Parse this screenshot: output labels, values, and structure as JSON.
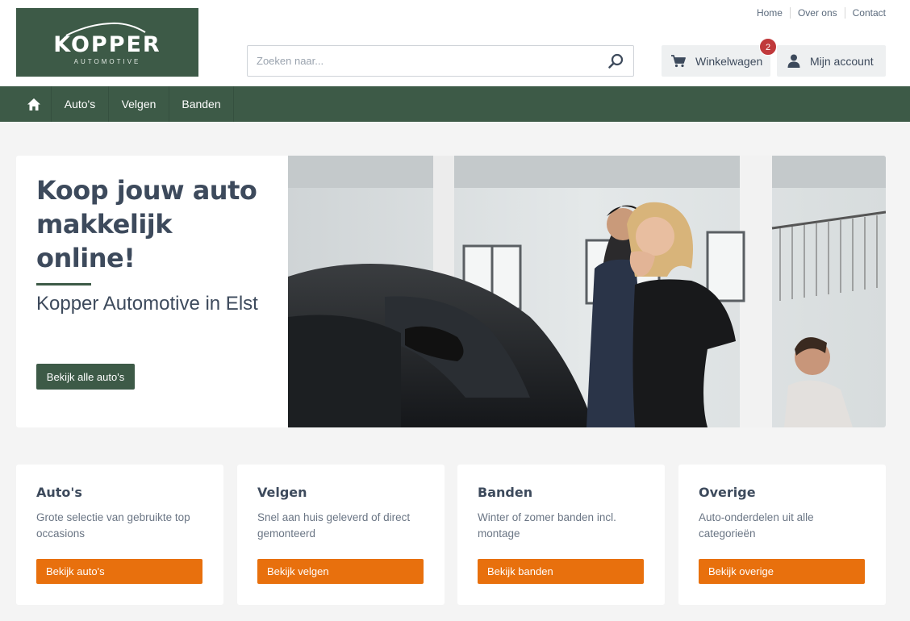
{
  "logo": {
    "word": "KOPPER",
    "sub": "AUTOMOTIVE"
  },
  "top_links": [
    "Home",
    "Over ons",
    "Contact"
  ],
  "search": {
    "placeholder": "Zoeken naar...",
    "value": ""
  },
  "cart": {
    "label": "Winkelwagen",
    "count": "2"
  },
  "account": {
    "label": "Mijn account"
  },
  "nav": {
    "items": [
      "Auto's",
      "Velgen",
      "Banden"
    ]
  },
  "hero": {
    "title": "Koop jouw auto makkelijk online!",
    "subtitle": "Kopper Automotive in Elst",
    "button": "Bekijk alle auto's"
  },
  "cards": [
    {
      "title": "Auto's",
      "desc": "Grote selectie van gebruikte top occasions",
      "button": "Bekijk auto's"
    },
    {
      "title": "Velgen",
      "desc": "Snel aan huis geleverd of direct gemonteerd",
      "button": "Bekijk velgen"
    },
    {
      "title": "Banden",
      "desc": "Winter of zomer banden incl. montage",
      "button": "Bekijk banden"
    },
    {
      "title": "Overige",
      "desc": "Auto-onderdelen uit alle categorieën",
      "button": "Bekijk overige"
    }
  ],
  "colors": {
    "brand_green": "#3d5a47",
    "accent_orange": "#e8700d",
    "badge_red": "#c0393b",
    "text": "#3d4a5c"
  },
  "icons": [
    "home-icon",
    "search-icon",
    "cart-icon",
    "user-icon"
  ]
}
